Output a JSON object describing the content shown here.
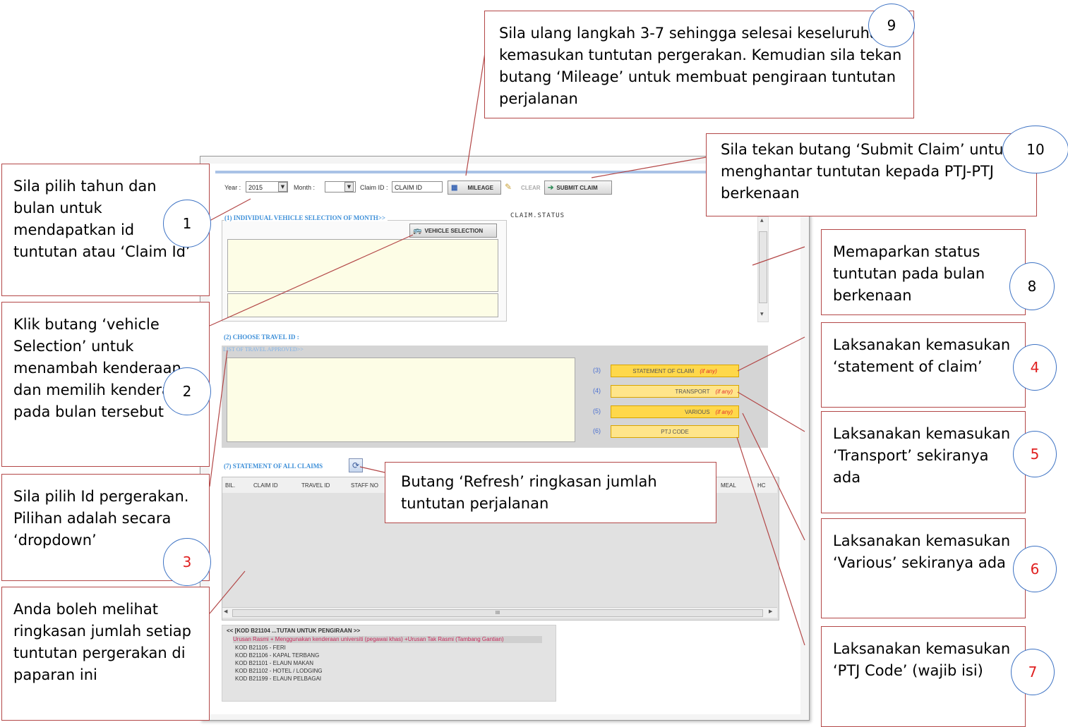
{
  "form": {
    "year_label": "Year :",
    "year_value": "2015",
    "month_label": "Month :",
    "month_value": "",
    "claim_id_label": "Claim ID :",
    "claim_id_value": "CLAIM ID",
    "toolbar": {
      "mileage_label": "MILEAGE",
      "clear_label": "CLEAR",
      "submit_label": "SUBMIT CLAIM"
    },
    "section1_title": "(1) INDIVIDUAL VEHICLE SELECTION OF MONTH>>",
    "vehicle_selection_label": "VEHICLE SELECTION",
    "claim_status_label": "CLAIM.STATUS",
    "section2_title": "(2) CHOOSE TRAVEL ID :",
    "list_of_travel_label": "LIST OF TRAVEL APPROVED>>",
    "claim_rows": [
      {
        "num": "(3)",
        "label": "STATEMENT OF CLAIM",
        "ifany": "(if any)"
      },
      {
        "num": "(4)",
        "label": "TRANSPORT",
        "ifany": "(if any)"
      },
      {
        "num": "(5)",
        "label": "VARIOUS",
        "ifany": "(if any)"
      },
      {
        "num": "(6)",
        "label": "PTJ CODE",
        "ifany": ""
      }
    ],
    "section7_title": "(7) STATEMENT OF ALL CLAIMS",
    "grid_columns": [
      "BIL.",
      "CLAIM ID",
      "TRAVEL ID",
      "STAFF NO",
      "MEAL",
      "HC"
    ],
    "codes_title": "<< [KOD B21104 ...TUTAN UNTUK PENGIRAAN >>",
    "codes_highlight": "Urusan Rasmi + Menggunakan kenderaan universiti (pegawai khas) +Urusan Tak Rasmi (Tambang Gantian)",
    "codes": [
      "KOD B21105 - FERI",
      "KOD B21106 - KAPAL TERBANG",
      "KOD B21101 - ELAUN MAKAN",
      "KOD B21102 - HOTEL / LODGING",
      "KOD B21199 - ELAUN PELBAGAI"
    ],
    "scroll_glyph": "III"
  },
  "callouts": {
    "c1": "Sila pilih tahun dan bulan untuk mendapatkan id tuntutan atau ‘Claim Id’",
    "c2": "Klik butang ‘vehicle Selection’ untuk menambah kenderaan dan memilih kenderaan pada bulan tersebut",
    "c3": "Sila pilih Id pergerakan. Pilihan adalah secara ‘dropdown’",
    "c_view": "Anda boleh melihat ringkasan jumlah setiap tuntutan pergerakan di paparan ini",
    "c9": "Sila ulang langkah 3-7 sehingga selesai keseluruhan kemasukan tuntutan pergerakan. Kemudian sila tekan butang ‘Mileage’ untuk membuat pengiraan tuntutan perjalanan",
    "c10": "Sila tekan butang ‘Submit Claim’ untuk menghantar tuntutan kepada PTJ-PTJ berkenaan",
    "c8": "Memaparkan status tuntutan pada bulan berkenaan",
    "c4": "Laksanakan kemasukan ‘statement of claim’",
    "c5": "Laksanakan kemasukan ‘Transport’ sekiranya ada",
    "c6": "Laksanakan kemasukan ‘Various’ sekiranya ada",
    "c7": "Laksanakan kemasukan ‘PTJ Code’ (wajib isi)",
    "refresh": "Butang ‘Refresh’ ringkasan jumlah tuntutan perjalanan"
  },
  "numbers": {
    "n1": "1",
    "n2": "2",
    "n3": "3",
    "n4": "4",
    "n5": "5",
    "n6": "6",
    "n7": "7",
    "n8": "8",
    "n9": "9",
    "n10": "10"
  },
  "colors": {
    "callout_border": "#b34747",
    "circle_border": "#3e73c4",
    "red_number": "#e02020",
    "section_title": "#3d8fd8",
    "yellow_panel": "#fdfde6",
    "claim_button": "#ffd84a"
  }
}
